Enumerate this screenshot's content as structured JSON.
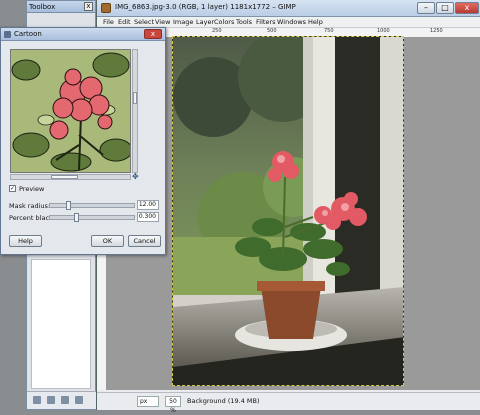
{
  "toolbox": {
    "title": "Toolbox",
    "close": "x"
  },
  "gimp": {
    "title": "IMG_6863.jpg-3.0 (RGB, 1 layer) 1181x1772 – GIMP",
    "menu": [
      "File",
      "Edit",
      "Select",
      "View",
      "Image",
      "Layer",
      "Colors",
      "Tools",
      "Filters",
      "Windows",
      "Help"
    ],
    "ruler_ticks": [
      "250",
      "500",
      "750",
      "1000",
      "1250"
    ],
    "status": {
      "unit": "px",
      "zoom": "50 %",
      "text": "Background (19.4 MB)"
    },
    "window_buttons": {
      "minimize": "–",
      "maximize": "□",
      "close": "x"
    }
  },
  "cartoon": {
    "title": "Cartoon",
    "close": "x",
    "preview_label": "Preview",
    "preview_checked": true,
    "mask_radius": {
      "label": "Mask radius:",
      "value": "12.00",
      "level": 0.2
    },
    "percent_black": {
      "label": "Percent black:",
      "value": "0.300",
      "level": 0.3
    },
    "buttons": {
      "help": "Help",
      "ok": "OK",
      "cancel": "Cancel"
    }
  },
  "colors": {
    "titlebar": "#b9cde6",
    "close_red": "#c9463d",
    "selection_border": "#d4c84a"
  }
}
